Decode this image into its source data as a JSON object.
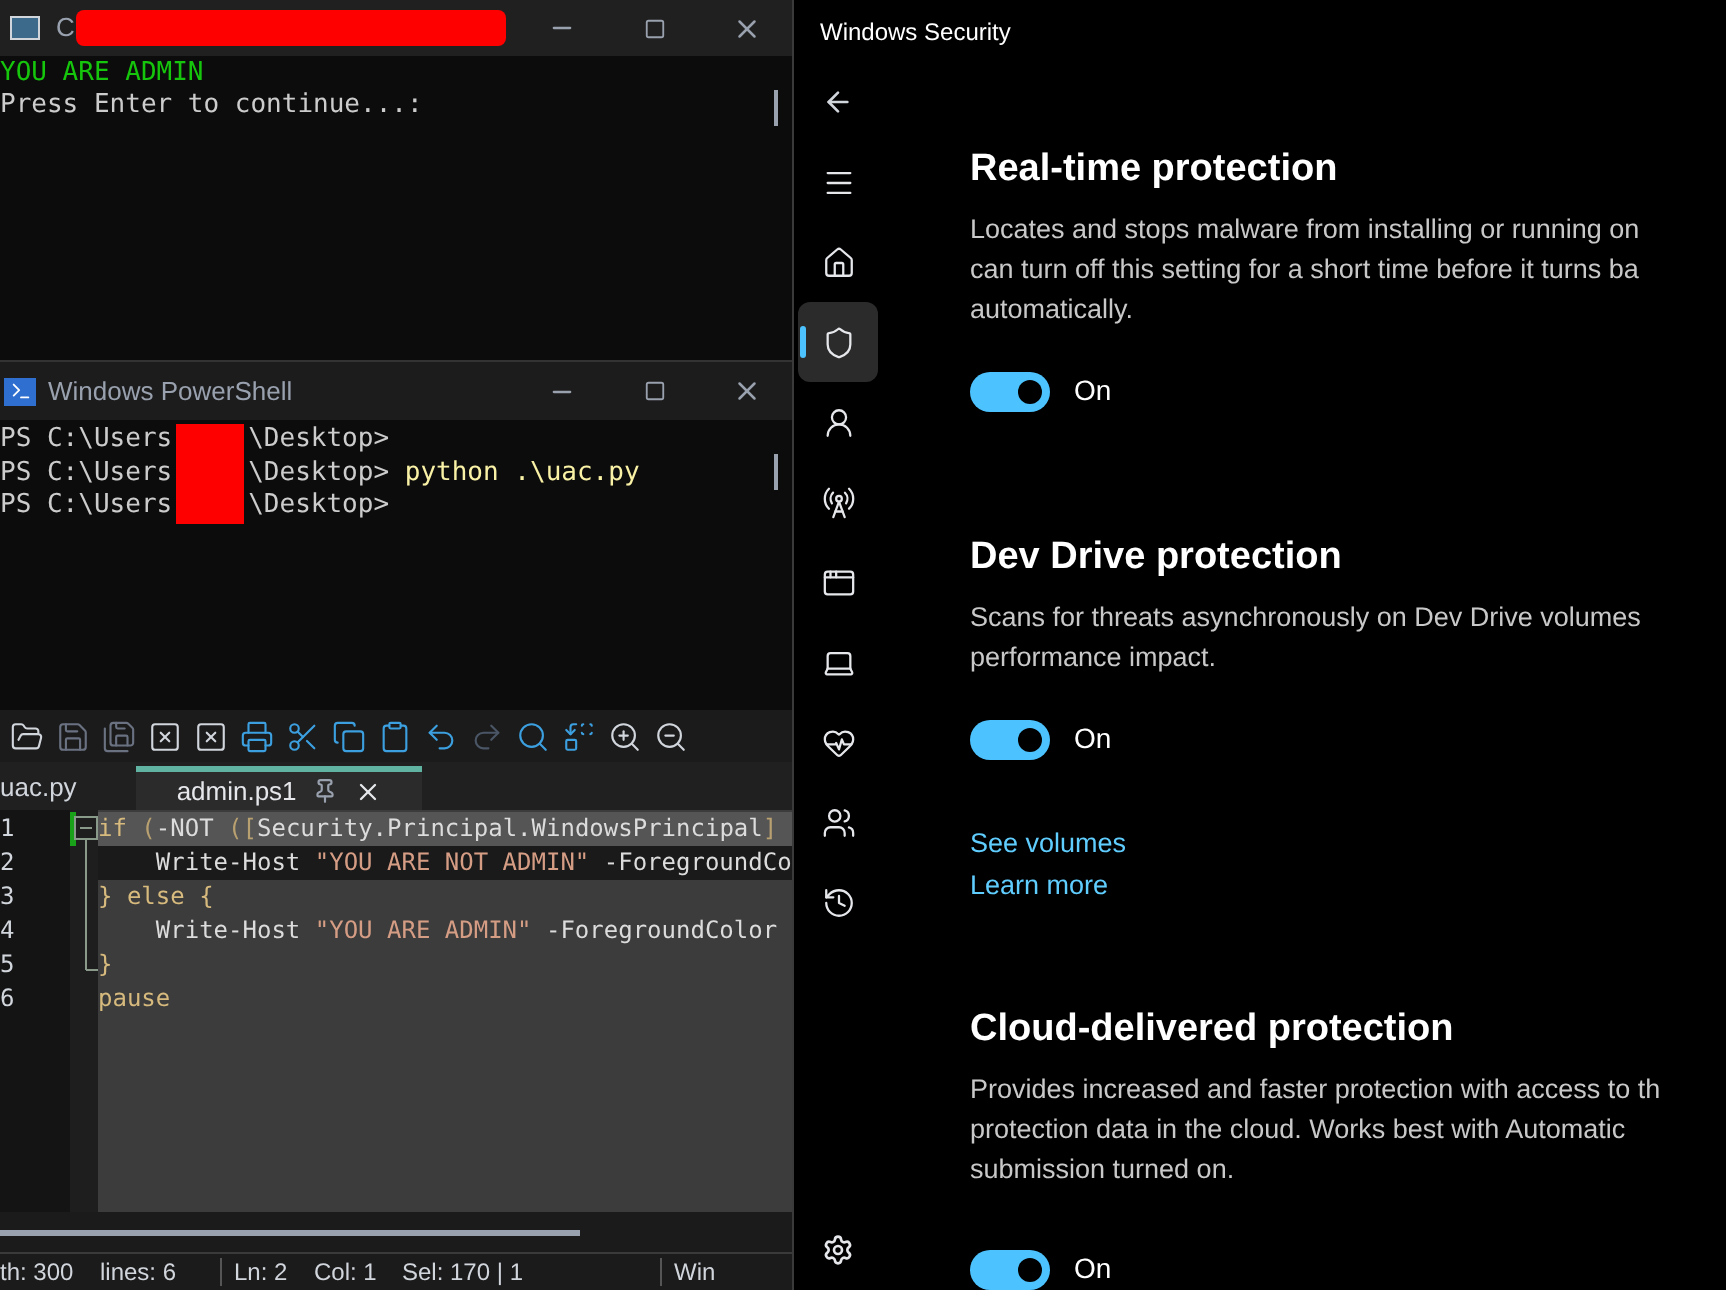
{
  "console_window": {
    "title": "C",
    "lines": [
      {
        "text": "YOU ARE ADMIN",
        "color": "#16c60c"
      },
      {
        "text": "Press Enter to continue...:",
        "color": "#cccccc"
      }
    ]
  },
  "powershell_window": {
    "title": "Windows PowerShell",
    "lines": [
      {
        "prefix": "PS C:\\Users",
        "suffix": "\\Desktop>"
      },
      {
        "prefix": "PS C:\\Users",
        "suffix": "\\Desktop>",
        "command": " python .\\uac.py"
      },
      {
        "prefix": "PS C:\\Users",
        "suffix": "\\Desktop>"
      }
    ]
  },
  "editor": {
    "tabs": [
      {
        "label": "uac.py",
        "selected": false
      },
      {
        "label": "admin.ps1",
        "selected": true
      }
    ],
    "lines": [
      {
        "number": "1",
        "selected": true,
        "current": false,
        "tokens": [
          {
            "text": "if",
            "kind": "keyword"
          },
          {
            "text": " (",
            "kind": "operator"
          },
          {
            "text": "-NOT",
            "kind": "plain"
          },
          {
            "text": " ([",
            "kind": "operator"
          },
          {
            "text": "Security.Principal.WindowsPrincipal",
            "kind": "plain"
          },
          {
            "text": "]",
            "kind": "operator"
          }
        ]
      },
      {
        "number": "2",
        "selected": false,
        "current": true,
        "tokens": [
          {
            "text": "    Write-Host ",
            "kind": "plain"
          },
          {
            "text": "\"YOU ARE NOT ADMIN\"",
            "kind": "string"
          },
          {
            "text": " -ForegroundCo",
            "kind": "plain"
          }
        ]
      },
      {
        "number": "3",
        "selected": false,
        "current": false,
        "tokens": [
          {
            "text": "} else {",
            "kind": "keyword"
          }
        ]
      },
      {
        "number": "4",
        "selected": false,
        "current": false,
        "tokens": [
          {
            "text": "    Write-Host ",
            "kind": "plain"
          },
          {
            "text": "\"YOU ARE ADMIN\"",
            "kind": "string"
          },
          {
            "text": " -ForegroundColor",
            "kind": "plain"
          }
        ]
      },
      {
        "number": "5",
        "selected": false,
        "current": false,
        "tokens": [
          {
            "text": "}",
            "kind": "keyword"
          }
        ]
      },
      {
        "number": "6",
        "selected": false,
        "current": false,
        "tokens": [
          {
            "text": "pause",
            "kind": "keyword"
          }
        ]
      }
    ],
    "status_bar": [
      "th: 300",
      "lines: 6",
      "Ln: 2",
      "Col: 1",
      "Sel: 170 | 1",
      "Win"
    ]
  },
  "security_window": {
    "title": "Windows Security",
    "nav": [
      {
        "selected": false
      },
      {
        "selected": false
      },
      {
        "selected": true
      },
      {
        "selected": false
      },
      {
        "selected": false
      },
      {
        "selected": false
      },
      {
        "selected": false
      },
      {
        "selected": false
      },
      {
        "selected": false
      },
      {
        "selected": false
      }
    ],
    "sections": [
      {
        "title": "Real-time protection",
        "description": [
          "Locates and stops malware from installing or running on",
          "can turn off this setting for a short time before it turns ba",
          "automatically."
        ],
        "toggle": {
          "on": true,
          "label": "On"
        }
      },
      {
        "title": "Dev Drive protection",
        "description": [
          "Scans for threats asynchronously on Dev Drive volumes",
          "performance impact."
        ],
        "toggle": {
          "on": true,
          "label": "On"
        },
        "links": [
          "See volumes",
          "Learn more"
        ]
      },
      {
        "title": "Cloud-delivered protection",
        "description": [
          "Provides increased and faster protection with access to th",
          "protection data in the cloud. Works best with Automatic",
          "submission turned on."
        ],
        "toggle": {
          "on": true,
          "label": "On"
        }
      }
    ]
  }
}
